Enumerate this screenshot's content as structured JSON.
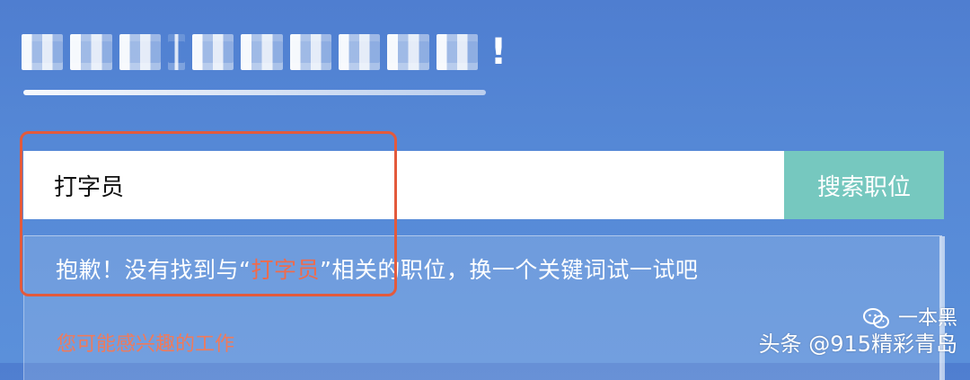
{
  "search": {
    "value": "打字员",
    "button_label": "搜索职位"
  },
  "results": {
    "no_results_prefix": "抱歉！没有找到与“",
    "no_results_keyword": "打字员",
    "no_results_suffix": "”相关的职位，换一个关键词试一试吧",
    "may_like": "您可能感兴趣的工作"
  },
  "watermark": {
    "author": "一本黑",
    "source": "头条 @915精彩青岛",
    "icon": "wechat-icon"
  },
  "colors": {
    "accent_teal": "#76c8bf",
    "highlight_red": "#f06b4b",
    "annotation_red": "#e35a3c",
    "background_blue": "#5588d6"
  }
}
